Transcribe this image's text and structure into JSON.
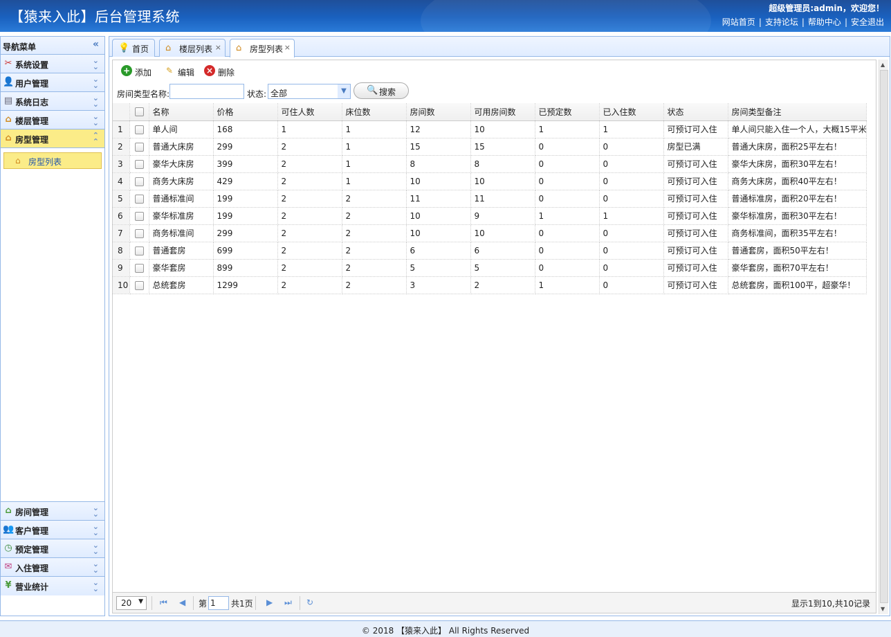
{
  "header": {
    "title": "【猿来入此】后台管理系统",
    "welcome": "超级管理员:admin，欢迎您！",
    "links": [
      "网站首页",
      "支持论坛",
      "帮助中心",
      "安全退出"
    ],
    "separator": "|"
  },
  "sidebar": {
    "title": "导航菜单",
    "collapse_icon": "«",
    "top_items": [
      {
        "label": "系统设置",
        "icon": "tools-icon"
      },
      {
        "label": "用户管理",
        "icon": "users-icon"
      },
      {
        "label": "系统日志",
        "icon": "log-icon"
      },
      {
        "label": "楼层管理",
        "icon": "house-icon"
      },
      {
        "label": "房型管理",
        "icon": "house-icon"
      }
    ],
    "sub_item": "房型列表",
    "bottom_items": [
      {
        "label": "房间管理",
        "icon": "house-icon"
      },
      {
        "label": "客户管理",
        "icon": "customer-icon"
      },
      {
        "label": "预定管理",
        "icon": "clock-icon"
      },
      {
        "label": "入住管理",
        "icon": "checkin-icon"
      },
      {
        "label": "营业统计",
        "icon": "yen-icon"
      }
    ]
  },
  "tabs": [
    {
      "label": "首页"
    },
    {
      "label": "楼层列表"
    },
    {
      "label": "房型列表"
    }
  ],
  "toolbar": {
    "add": "添加",
    "edit": "编辑",
    "delete": "删除"
  },
  "search": {
    "name_label": "房间类型名称:",
    "name_value": "",
    "status_label": "状态:",
    "status_value": "全部",
    "search_button": "搜索"
  },
  "table": {
    "columns": [
      "名称",
      "价格",
      "可住人数",
      "床位数",
      "房间数",
      "可用房间数",
      "已预定数",
      "已入住数",
      "状态",
      "房间类型备注"
    ],
    "rows": [
      [
        "1",
        "单人间",
        "168",
        "1",
        "1",
        "12",
        "10",
        "1",
        "1",
        "可预订可入住",
        "单人间只能入住一个人，大概15平米"
      ],
      [
        "2",
        "普通大床房",
        "299",
        "2",
        "1",
        "15",
        "15",
        "0",
        "0",
        "房型已满",
        "普通大床房，面积25平左右！"
      ],
      [
        "3",
        "豪华大床房",
        "399",
        "2",
        "1",
        "8",
        "8",
        "0",
        "0",
        "可预订可入住",
        "豪华大床房，面积30平左右！"
      ],
      [
        "4",
        "商务大床房",
        "429",
        "2",
        "1",
        "10",
        "10",
        "0",
        "0",
        "可预订可入住",
        "商务大床房，面积40平左右！"
      ],
      [
        "5",
        "普通标准间",
        "199",
        "2",
        "2",
        "11",
        "11",
        "0",
        "0",
        "可预订可入住",
        "普通标准房，面积20平左右！"
      ],
      [
        "6",
        "豪华标准房",
        "199",
        "2",
        "2",
        "10",
        "9",
        "1",
        "1",
        "可预订可入住",
        "豪华标准房，面积30平左右！"
      ],
      [
        "7",
        "商务标准间",
        "299",
        "2",
        "2",
        "10",
        "10",
        "0",
        "0",
        "可预订可入住",
        "商务标准间，面积35平左右！"
      ],
      [
        "8",
        "普通套房",
        "699",
        "2",
        "2",
        "6",
        "6",
        "0",
        "0",
        "可预订可入住",
        "普通套房，面积50平左右！"
      ],
      [
        "9",
        "豪华套房",
        "899",
        "2",
        "2",
        "5",
        "5",
        "0",
        "0",
        "可预订可入住",
        "豪华套房，面积70平左右！"
      ],
      [
        "10",
        "总统套房",
        "1299",
        "2",
        "2",
        "3",
        "2",
        "1",
        "0",
        "可预订可入住",
        "总统套房，面积100平，超豪华！"
      ]
    ]
  },
  "pager": {
    "page_size": "20",
    "page_prefix": "第",
    "page_value": "1",
    "page_total": "共1页",
    "summary": "显示1到10,共10记录"
  },
  "footer": {
    "text": "© 2018 【猿来入此】 All Rights Reserved"
  }
}
